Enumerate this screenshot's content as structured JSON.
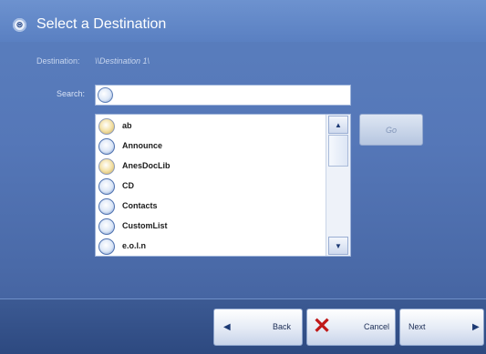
{
  "window": {
    "title": "Select a Destination"
  },
  "destination": {
    "label": "Destination:",
    "value": "\\\\Destination 1\\"
  },
  "search": {
    "label": "Search:",
    "value": "",
    "placeholder": ""
  },
  "list": {
    "items": [
      {
        "label": "ab",
        "icon": "folder-icon"
      },
      {
        "label": "Announce",
        "icon": "globe-icon"
      },
      {
        "label": "AnesDocLib",
        "icon": "folder-icon"
      },
      {
        "label": "CD",
        "icon": "globe-icon"
      },
      {
        "label": "Contacts",
        "icon": "globe-icon"
      },
      {
        "label": "CustomList",
        "icon": "globe-icon"
      },
      {
        "label": "e.o.l.n",
        "icon": "globe-icon"
      }
    ]
  },
  "go_button": {
    "label": "Go"
  },
  "footer": {
    "back_label": "Back",
    "cancel_label": "Cancel",
    "next_label": "Next"
  }
}
